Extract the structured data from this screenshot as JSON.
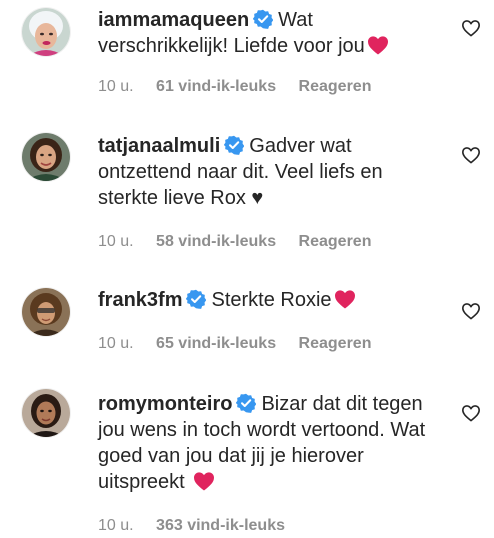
{
  "comments": [
    {
      "username": "iammamaqueen",
      "text": "Wat verschrikkelijk! Liefde voor jou",
      "emoji": "red-heart",
      "time": "10 u.",
      "likes": "61 vind-ik-leuks",
      "reply": "Reageren"
    },
    {
      "username": "tatjanaalmuli",
      "text": "Gadver wat ontzettend naar dit. Veel liefs en sterkte lieve Rox ♥",
      "time": "10 u.",
      "likes": "58 vind-ik-leuks",
      "reply": "Reageren"
    },
    {
      "username": "frank3fm",
      "text": "Sterkte Roxie",
      "emoji": "red-heart",
      "time": "10 u.",
      "likes": "65 vind-ik-leuks",
      "reply": "Reageren"
    },
    {
      "username": "romymonteiro",
      "text": "Bizar dat dit tegen jou wens in toch wordt vertoond. Wat goed van jou dat jij je hierover uitspreekt",
      "emoji": "red-heart",
      "time": "10 u.",
      "likes": "363 vind-ik-leuks"
    }
  ],
  "icons": {
    "verified": "verified-badge-icon",
    "like": "heart-outline-icon",
    "emoji": "red-heart"
  },
  "colors": {
    "text": "#262626",
    "meta": "#8e8e8e",
    "verified": "#3897f0",
    "heart": "#e0245e"
  }
}
